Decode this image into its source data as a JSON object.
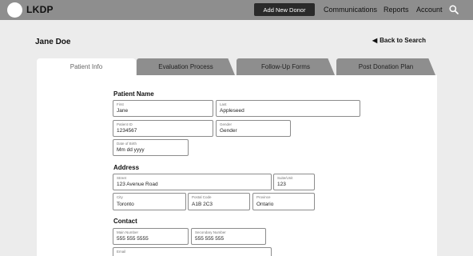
{
  "app": {
    "logo_text": "LKDP"
  },
  "topbar": {
    "add_donor_label": "Add New Donor",
    "nav": {
      "communications": "Communications",
      "reports": "Reports",
      "account": "Account"
    },
    "search_icon": "search-icon"
  },
  "header": {
    "patient_name": "Jane Doe",
    "back_label": "Back to Search",
    "back_icon": "chevron-left-icon"
  },
  "tabs": [
    {
      "label": "Patient Info",
      "active": true
    },
    {
      "label": "Evaluation Process",
      "active": false
    },
    {
      "label": "Follow-Up Forms",
      "active": false
    },
    {
      "label": "Post Donation Plan",
      "active": false
    }
  ],
  "form": {
    "patient_name_section": "Patient Name",
    "first": {
      "label": "First",
      "value": "Jane"
    },
    "last": {
      "label": "Last",
      "value": "Appleseed"
    },
    "patient_id": {
      "label": "Patient ID",
      "value": "1234567"
    },
    "gender": {
      "label": "Gender",
      "value": "Gender"
    },
    "dob": {
      "label": "Date of Birth",
      "value": "Mm dd yyyy"
    },
    "address_section": "Address",
    "street": {
      "label": "Street",
      "value": "123 Avenue Road"
    },
    "suite": {
      "label": "Suite/Unit",
      "value": "123"
    },
    "city": {
      "label": "City",
      "value": "Toronto"
    },
    "postal": {
      "label": "Postal Code",
      "value": "A1B 2C3"
    },
    "province": {
      "label": "Province",
      "value": "Ontario"
    },
    "contact_section": "Contact",
    "main_number": {
      "label": "Main Number",
      "value": "555 555 5555"
    },
    "secondary_number": {
      "label": "Secondary Number",
      "value": "555 555 555"
    },
    "email": {
      "label": "Email",
      "value": ""
    }
  }
}
